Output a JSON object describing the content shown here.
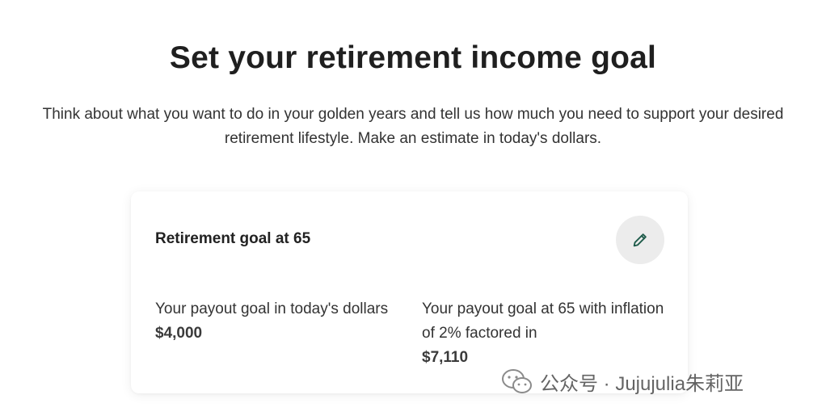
{
  "header": {
    "title": "Set your retirement income goal",
    "subtitle": "Think about what you want to do in your golden years and tell us how much you need to support your desired retirement lifestyle. Make an estimate in today's dollars."
  },
  "card": {
    "title": "Retirement goal at 65",
    "edit_icon": "pencil-icon",
    "today": {
      "label": "Your payout goal in today's dollars",
      "value": "$4,000"
    },
    "inflation": {
      "label": "Your payout goal at 65 with inflation of 2% factored in",
      "value": "$7,110"
    }
  },
  "watermark": {
    "icon": "wechat-icon",
    "text": "公众号 · Jujujulia朱莉亚"
  },
  "colors": {
    "accent_icon": "#1e5b4a",
    "edit_button_bg": "#ececec"
  }
}
